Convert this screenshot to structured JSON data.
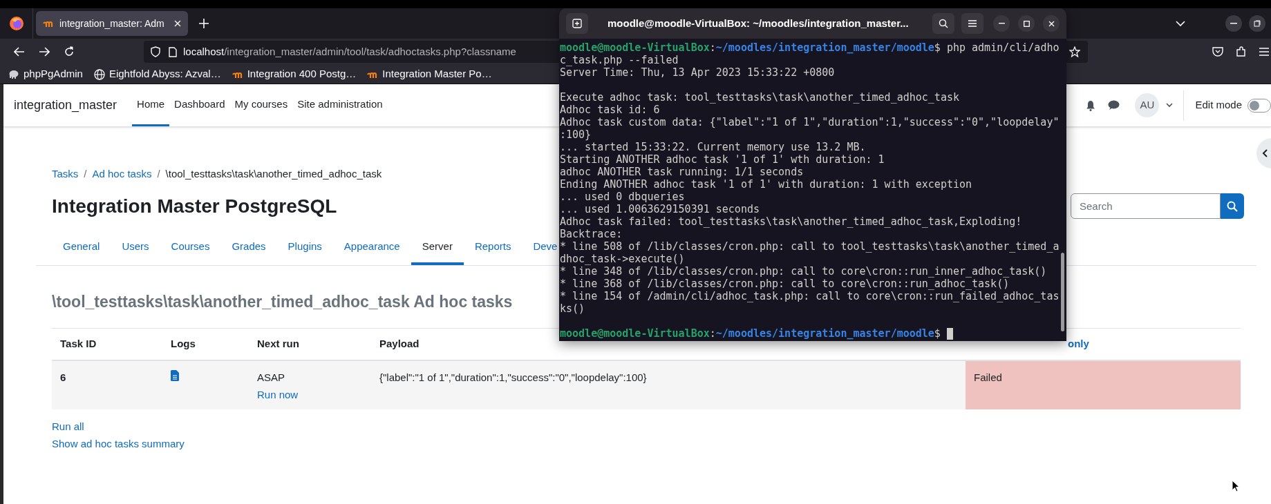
{
  "browser": {
    "tabs": [
      {
        "title": "integration_master: Adm",
        "selected": true
      }
    ],
    "url": {
      "host": "localhost",
      "path": "/integration_master/admin/tool/task/adhoctasks.php?classname"
    },
    "bookmarks": [
      {
        "label": "phpPgAdmin",
        "kind": "elephant"
      },
      {
        "label": "Eightfold Abyss: Azval…",
        "kind": "globe"
      },
      {
        "label": "Integration 400 Postg…",
        "kind": "moodle"
      },
      {
        "label": "Integration Master Po…",
        "kind": "moodle"
      }
    ]
  },
  "site": {
    "name": "integration_master",
    "nav": [
      {
        "label": "Home",
        "selected": true
      },
      {
        "label": "Dashboard",
        "selected": false
      },
      {
        "label": "My courses",
        "selected": false
      },
      {
        "label": "Site administration",
        "selected": false
      }
    ],
    "user_initials": "AU",
    "edit_mode": {
      "label": "Edit mode",
      "on": false
    }
  },
  "breadcrumb": [
    {
      "label": "Tasks",
      "kind": "link"
    },
    {
      "label": "Ad hoc tasks",
      "kind": "link",
      "separator": "/"
    },
    {
      "label": "\\tool_testtasks\\task\\another_timed_adhoc_task",
      "kind": "current",
      "separator": "/"
    }
  ],
  "page_title": "Integration Master PostgreSQL",
  "search": {
    "placeholder": "Search"
  },
  "admin_tabs": [
    {
      "label": "General",
      "selected": false
    },
    {
      "label": "Users",
      "selected": false
    },
    {
      "label": "Courses",
      "selected": false
    },
    {
      "label": "Grades",
      "selected": false
    },
    {
      "label": "Plugins",
      "selected": false
    },
    {
      "label": "Appearance",
      "selected": false
    },
    {
      "label": "Server",
      "selected": true
    },
    {
      "label": "Reports",
      "selected": false
    },
    {
      "label": "Deve",
      "selected": false
    }
  ],
  "section_title": "\\tool_testtasks\\task\\another_timed_adhoc_task Ad hoc tasks",
  "table": {
    "columns": [
      "Task ID",
      "Logs",
      "Next run",
      "Payload"
    ],
    "column_5_link": "only",
    "rows": [
      {
        "task_id": "6",
        "next_run": "ASAP",
        "run_now": "Run now",
        "payload": "{\"label\":\"1 of 1\",\"duration\":1,\"success\":\"0\",\"loopdelay\":100}",
        "status": "Failed",
        "failed": true
      }
    ]
  },
  "links": [
    "Run all",
    "Show ad hoc tasks summary"
  ],
  "terminal": {
    "title": "moodle@moodle-VirtualBox: ~/moodles/integration_master...",
    "lines": [
      {
        "kind": "prompt",
        "user_host": "moodle@moodle-VirtualBox",
        "sep": ":",
        "path": "~/moodles/integration_master/moodle",
        "rest": "$ php admin/cli/adho"
      },
      {
        "kind": "text",
        "text": "c_task.php --failed"
      },
      {
        "kind": "text",
        "text": "Server Time: Thu, 13 Apr 2023 15:33:22 +0800"
      },
      {
        "kind": "blank"
      },
      {
        "kind": "text",
        "text": "Execute adhoc task: tool_testtasks\\task\\another_timed_adhoc_task"
      },
      {
        "kind": "text",
        "text": "Adhoc task id: 6"
      },
      {
        "kind": "text",
        "text": "Adhoc task custom data: {\"label\":\"1 of 1\",\"duration\":1,\"success\":\"0\",\"loopdelay\""
      },
      {
        "kind": "text",
        "text": ":100}"
      },
      {
        "kind": "text",
        "text": "... started 15:33:22. Current memory use 13.2 MB."
      },
      {
        "kind": "text",
        "text": "Starting ANOTHER adhoc task '1 of 1' wth duration: 1"
      },
      {
        "kind": "text",
        "text": "adhoc ANOTHER task running: 1/1 seconds"
      },
      {
        "kind": "text",
        "text": "Ending ANOTHER adhoc task '1 of 1' with duration: 1 with exception"
      },
      {
        "kind": "text",
        "text": "... used 0 dbqueries"
      },
      {
        "kind": "text",
        "text": "... used 1.0063629150391 seconds"
      },
      {
        "kind": "text",
        "text": "Adhoc task failed: tool_testtasks\\task\\another_timed_adhoc_task,Exploding!"
      },
      {
        "kind": "text",
        "text": "Backtrace:"
      },
      {
        "kind": "text",
        "text": "* line 508 of /lib/classes/cron.php: call to tool_testtasks\\task\\another_timed_a"
      },
      {
        "kind": "text",
        "text": "dhoc_task->execute()"
      },
      {
        "kind": "text",
        "text": "* line 348 of /lib/classes/cron.php: call to core\\cron::run_inner_adhoc_task()"
      },
      {
        "kind": "text",
        "text": "* line 368 of /lib/classes/cron.php: call to core\\cron::run_adhoc_task()"
      },
      {
        "kind": "text",
        "text": "* line 154 of /admin/cli/adhoc_task.php: call to core\\cron::run_failed_adhoc_tas"
      },
      {
        "kind": "text",
        "text": "ks()"
      },
      {
        "kind": "blank"
      },
      {
        "kind": "prompt",
        "user_host": "moodle@moodle-VirtualBox",
        "sep": ":",
        "path": "~/moodles/integration_master/moodle",
        "rest": "$",
        "cursor": true
      }
    ]
  }
}
